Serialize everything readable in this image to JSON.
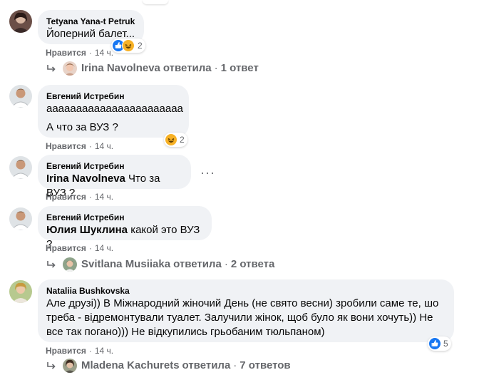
{
  "comments": [
    {
      "author": "Tetyana Yana-t Petruk",
      "text": "Йоперний балет...",
      "like_label": "Нравится",
      "time": "14 ч.",
      "reactions_count": "2"
    },
    {
      "author": "Евгений Истребин",
      "text_line1": "ааааааааааааааааааааааа",
      "text_line2": "А что за ВУЗ ?",
      "like_label": "Нравится",
      "time": "14 ч.",
      "reactions_count": "2"
    },
    {
      "author": "Евгений Истребин",
      "mention": "Irina Navolneva",
      "text": " Что за ВУЗ ?",
      "like_label": "Нравится",
      "time": "14 ч.",
      "more": "···"
    },
    {
      "author": "Евгений Истребин",
      "mention": "Юлия Шуклина",
      "text": " какой это ВУЗ ?",
      "like_label": "Нравится",
      "time": "14 ч."
    },
    {
      "author": "Nataliia Bushkovska",
      "text_line1": "Але друзі)) В Міжнародний жіночий День (не свято весни) зробили саме те, шо",
      "text_line2": "треба - відремонтували туалет. Залучили жінок, щоб було як вони хочуть)) Не",
      "text_line3": "все так погано))) Не відкупились грьобаним тюльпаном)",
      "like_label": "Нравится",
      "time": "14 ч.",
      "reactions_count": "5"
    }
  ],
  "replies": [
    {
      "name": "Irina Navolneva",
      "action": "ответила",
      "count": "1 ответ"
    },
    {
      "name": "Svitlana Musiiaka",
      "action": "ответила",
      "count": "2 ответа"
    },
    {
      "name": "Mladena Kachurets",
      "action": "ответила",
      "count": "7 ответов"
    }
  ],
  "separator": "·",
  "colors": {
    "bubble": "#f0f2f5",
    "meta": "#65676b",
    "like_blue": "#1877f2",
    "haha_yellow": "#f7b125"
  }
}
